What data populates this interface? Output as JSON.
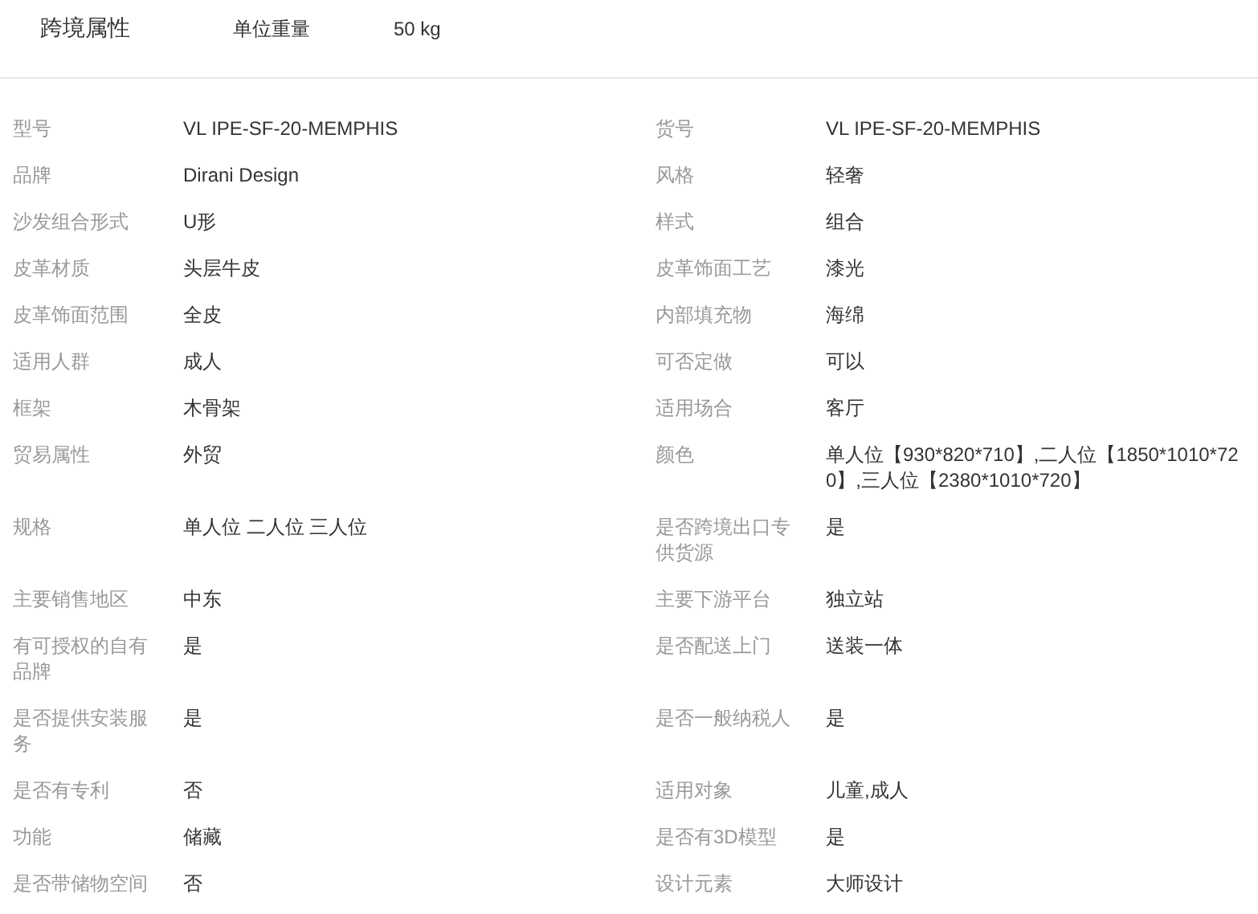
{
  "header": {
    "title": "跨境属性",
    "fields": [
      {
        "label": "单位重量",
        "value": "50 kg"
      }
    ]
  },
  "attributes": [
    {
      "label": "型号",
      "value": "VL IPE-SF-20-MEMPHIS"
    },
    {
      "label": "货号",
      "value": "VL IPE-SF-20-MEMPHIS"
    },
    {
      "label": "品牌",
      "value": "Dirani Design"
    },
    {
      "label": "风格",
      "value": "轻奢"
    },
    {
      "label": "沙发组合形式",
      "value": "U形"
    },
    {
      "label": "样式",
      "value": "组合"
    },
    {
      "label": "皮革材质",
      "value": "头层牛皮"
    },
    {
      "label": "皮革饰面工艺",
      "value": "漆光"
    },
    {
      "label": "皮革饰面范围",
      "value": "全皮"
    },
    {
      "label": "内部填充物",
      "value": "海绵"
    },
    {
      "label": "适用人群",
      "value": "成人"
    },
    {
      "label": "可否定做",
      "value": "可以"
    },
    {
      "label": "框架",
      "value": "木骨架"
    },
    {
      "label": "适用场合",
      "value": "客厅"
    },
    {
      "label": "贸易属性",
      "value": "外贸"
    },
    {
      "label": "颜色",
      "value": "单人位【930*820*710】,二人位【1850*1010*720】,三人位【2380*1010*720】"
    },
    {
      "label": "规格",
      "value": "单人位 二人位 三人位"
    },
    {
      "label": "是否跨境出口专供货源",
      "value": "是"
    },
    {
      "label": "主要销售地区",
      "value": "中东"
    },
    {
      "label": "主要下游平台",
      "value": "独立站"
    },
    {
      "label": "有可授权的自有品牌",
      "value": "是"
    },
    {
      "label": "是否配送上门",
      "value": "送装一体"
    },
    {
      "label": "是否提供安装服务",
      "value": "是"
    },
    {
      "label": "是否一般纳税人",
      "value": "是"
    },
    {
      "label": "是否有专利",
      "value": "否"
    },
    {
      "label": "适用对象",
      "value": "儿童,成人"
    },
    {
      "label": "功能",
      "value": "储藏"
    },
    {
      "label": "是否有3D模型",
      "value": "是"
    },
    {
      "label": "是否带储物空间",
      "value": "否"
    },
    {
      "label": "设计元素",
      "value": "大师设计"
    }
  ]
}
